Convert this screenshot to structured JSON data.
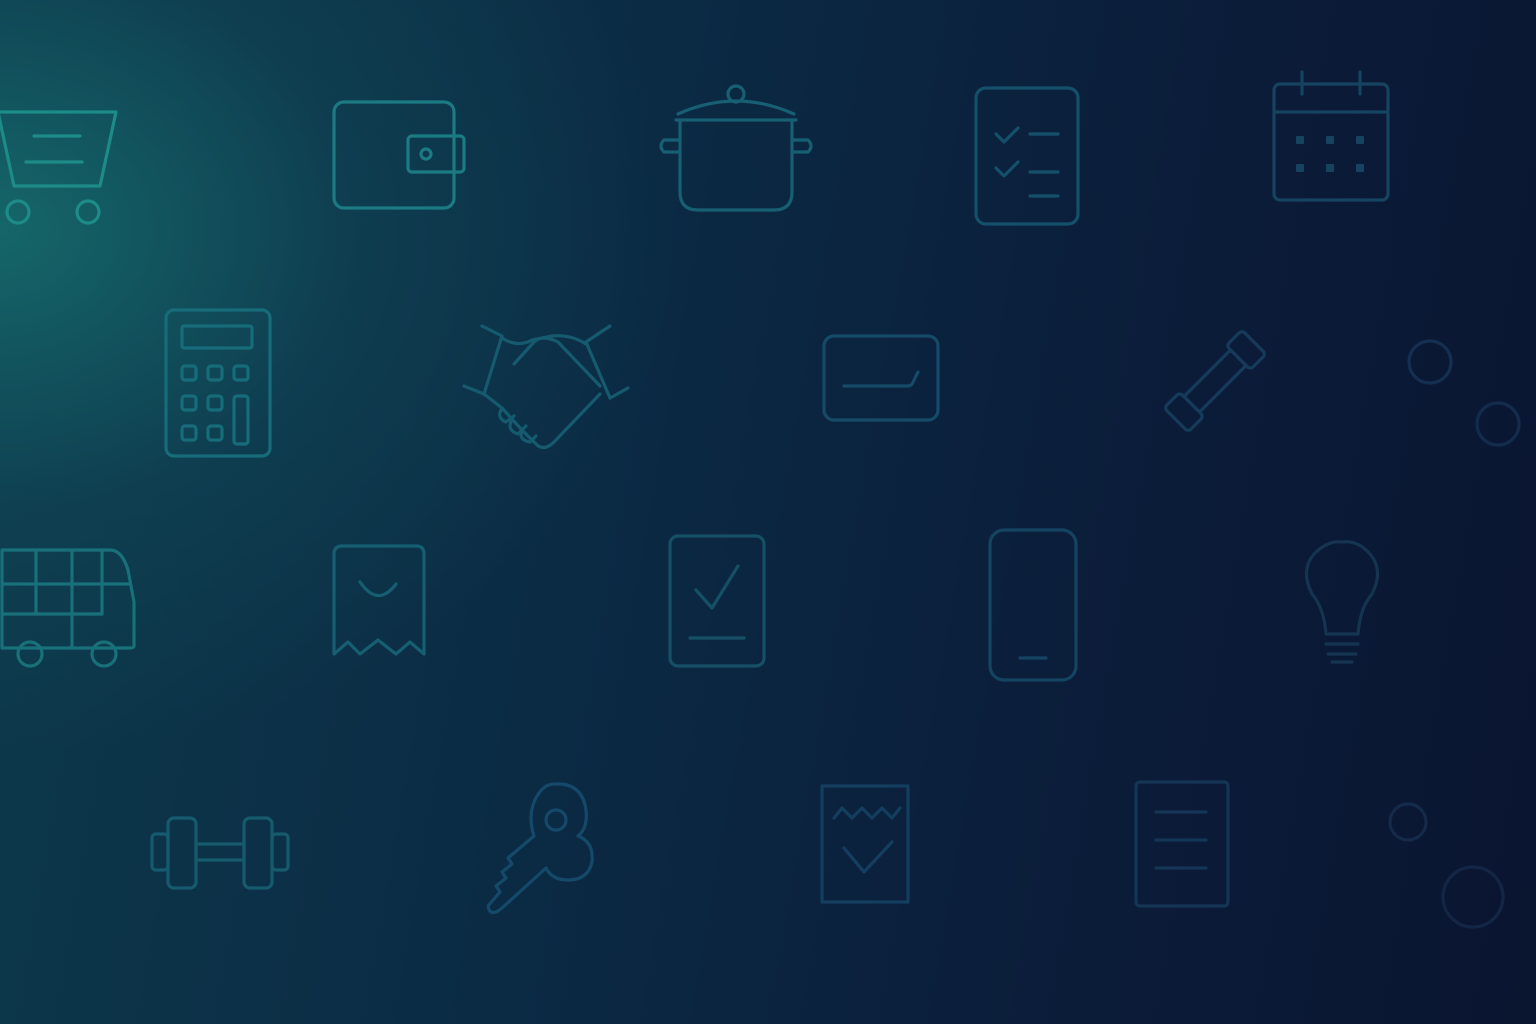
{
  "background": {
    "colors": {
      "top_left_glow": "#176e6e",
      "mid": "#0b2a44",
      "right": "#0a1530"
    }
  },
  "icons": [
    {
      "name": "shopping-cart-icon",
      "color": "#1d8c88"
    },
    {
      "name": "wallet-icon",
      "color": "#1b7a82"
    },
    {
      "name": "cooking-pot-icon",
      "color": "#175f73"
    },
    {
      "name": "checklist-icon",
      "color": "#15506b"
    },
    {
      "name": "calendar-icon",
      "color": "#16435f"
    },
    {
      "name": "calculator-icon",
      "color": "#176c7a"
    },
    {
      "name": "handshake-icon",
      "color": "#165a70"
    },
    {
      "name": "credit-card-icon",
      "color": "#154b68"
    },
    {
      "name": "dumbbell-small-icon",
      "color": "#163b5a"
    },
    {
      "name": "circle-small-icon",
      "color": "#152f50"
    },
    {
      "name": "circle-small-2-icon",
      "color": "#142c4c"
    },
    {
      "name": "bus-icon",
      "color": "#187079"
    },
    {
      "name": "receipt-icon",
      "color": "#165f72"
    },
    {
      "name": "tablet-check-icon",
      "color": "#155066"
    },
    {
      "name": "smartphone-icon",
      "color": "#154462"
    },
    {
      "name": "lightbulb-icon",
      "color": "#15344f"
    },
    {
      "name": "dumbbell-icon",
      "color": "#165a6e"
    },
    {
      "name": "key-icon",
      "color": "#15496a"
    },
    {
      "name": "receipt-check-icon",
      "color": "#143e60"
    },
    {
      "name": "document-icon",
      "color": "#143556"
    },
    {
      "name": "circle-small-3-icon",
      "color": "#142a49"
    },
    {
      "name": "circle-small-4-icon",
      "color": "#132645"
    }
  ]
}
